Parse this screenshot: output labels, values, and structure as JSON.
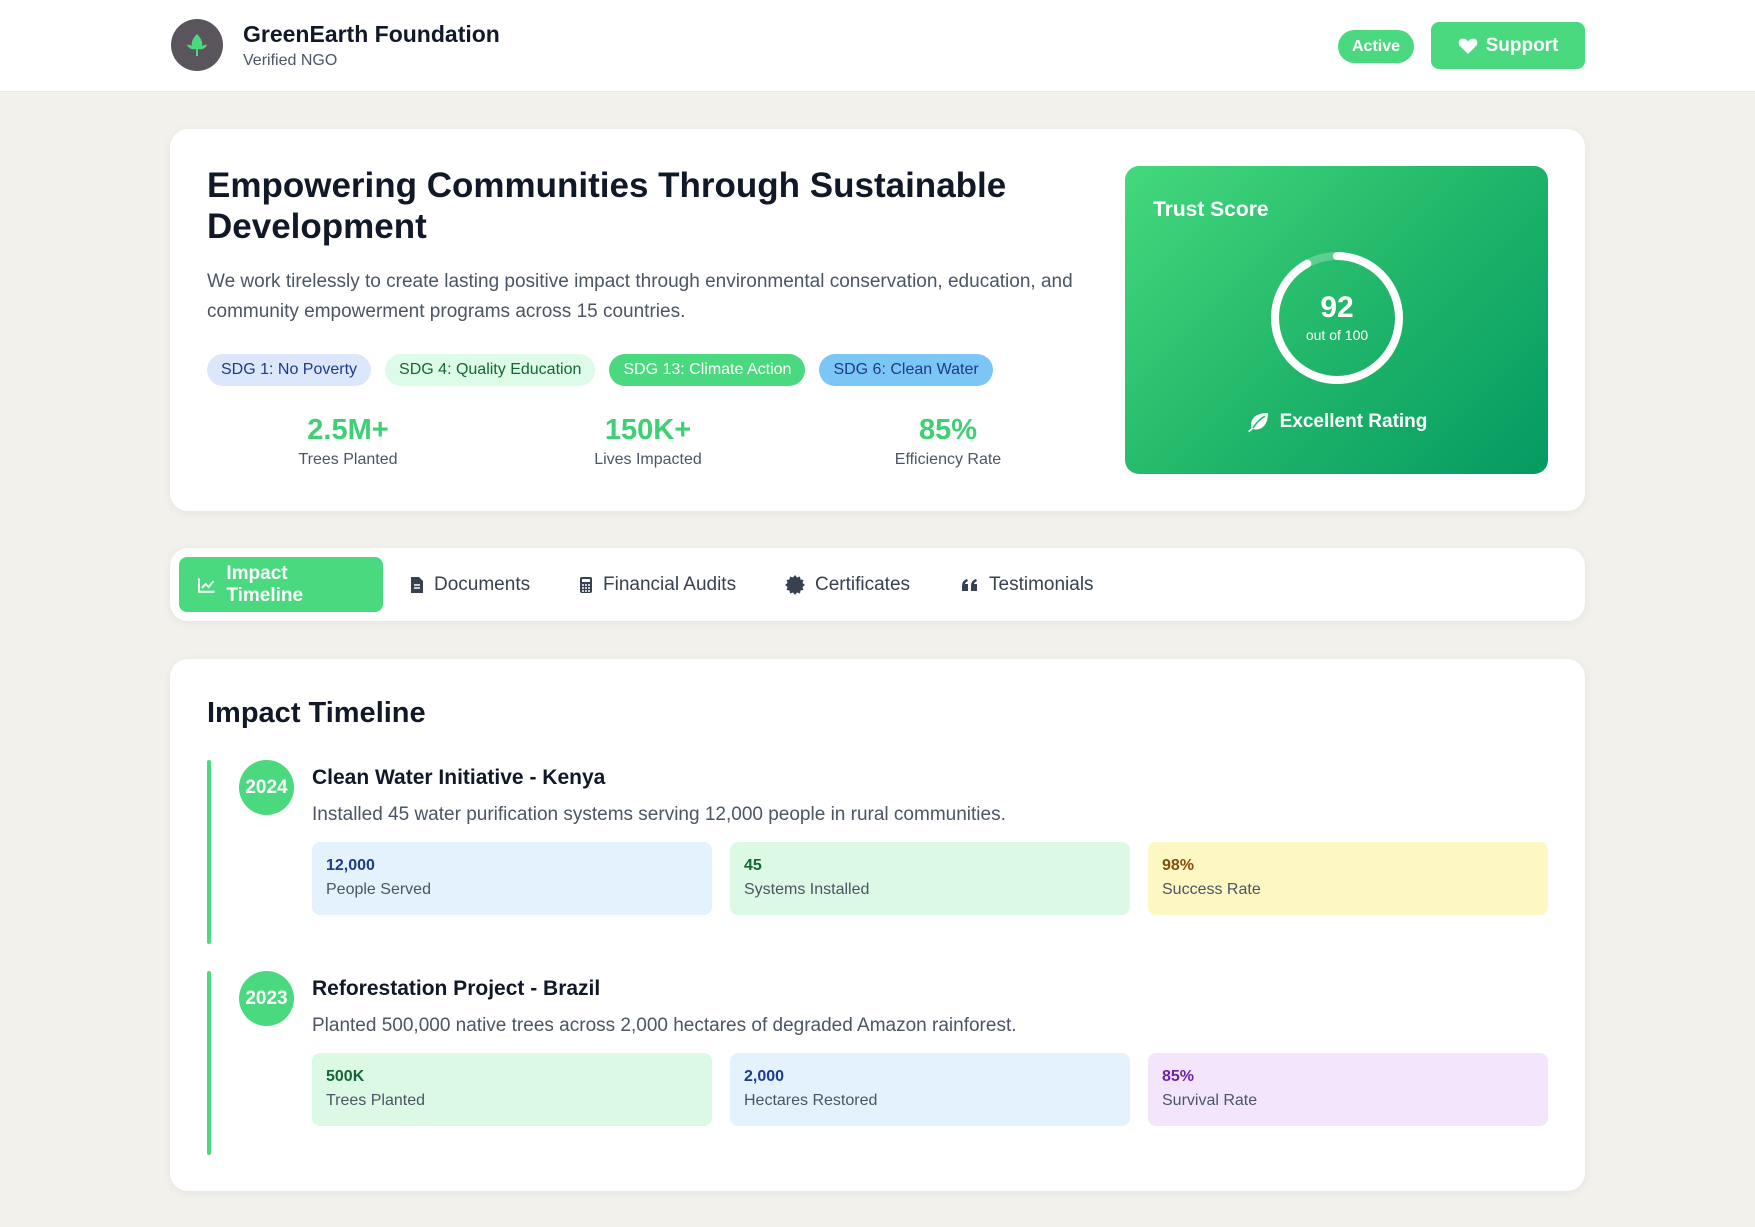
{
  "header": {
    "org_name": "GreenEarth Foundation",
    "org_subtitle": "Verified NGO",
    "logo_icon": "leaf-icon",
    "status_badge": "Active",
    "support_label": "Support",
    "support_icon": "heart-icon"
  },
  "hero": {
    "title": "Empowering Communities Through Sustainable Development",
    "description": "We work tirelessly to create lasting positive impact through environmental conservation, education, and community empowerment programs across 15 countries.",
    "sdgs": [
      {
        "label": "SDG 1: No Poverty"
      },
      {
        "label": "SDG 4: Quality Education"
      },
      {
        "label": "SDG 13: Climate Action"
      },
      {
        "label": "SDG 6: Clean Water"
      }
    ],
    "stats": [
      {
        "value": "2.5M+",
        "label": "Trees Planted"
      },
      {
        "value": "150K+",
        "label": "Lives Impacted"
      },
      {
        "value": "85%",
        "label": "Efficiency Rate"
      }
    ]
  },
  "trust": {
    "title": "Trust Score",
    "score": "92",
    "score_fraction": 0.92,
    "out_of": "out of 100",
    "rating": "Excellent Rating",
    "rating_icon": "leaf-icon"
  },
  "tabs": [
    {
      "label": "Impact Timeline",
      "icon": "chart-line-icon",
      "active": true
    },
    {
      "label": "Documents",
      "icon": "document-icon",
      "active": false
    },
    {
      "label": "Financial Audits",
      "icon": "calculator-icon",
      "active": false
    },
    {
      "label": "Certificates",
      "icon": "certificate-icon",
      "active": false
    },
    {
      "label": "Testimonials",
      "icon": "quote-icon",
      "active": false
    }
  ],
  "timeline": {
    "title": "Impact Timeline",
    "items": [
      {
        "year": "2024",
        "title": "Clean Water Initiative - Kenya",
        "description": "Installed 45 water purification systems serving 12,000 people in rural communities.",
        "metrics": [
          {
            "value": "12,000",
            "label": "People Served"
          },
          {
            "value": "45",
            "label": "Systems Installed"
          },
          {
            "value": "98%",
            "label": "Success Rate"
          }
        ]
      },
      {
        "year": "2023",
        "title": "Reforestation Project - Brazil",
        "description": "Planted 500,000 native trees across 2,000 hectares of degraded Amazon rainforest.",
        "metrics": [
          {
            "value": "500K",
            "label": "Trees Planted"
          },
          {
            "value": "2,000",
            "label": "Hectares Restored"
          },
          {
            "value": "85%",
            "label": "Survival Rate"
          }
        ]
      }
    ]
  }
}
